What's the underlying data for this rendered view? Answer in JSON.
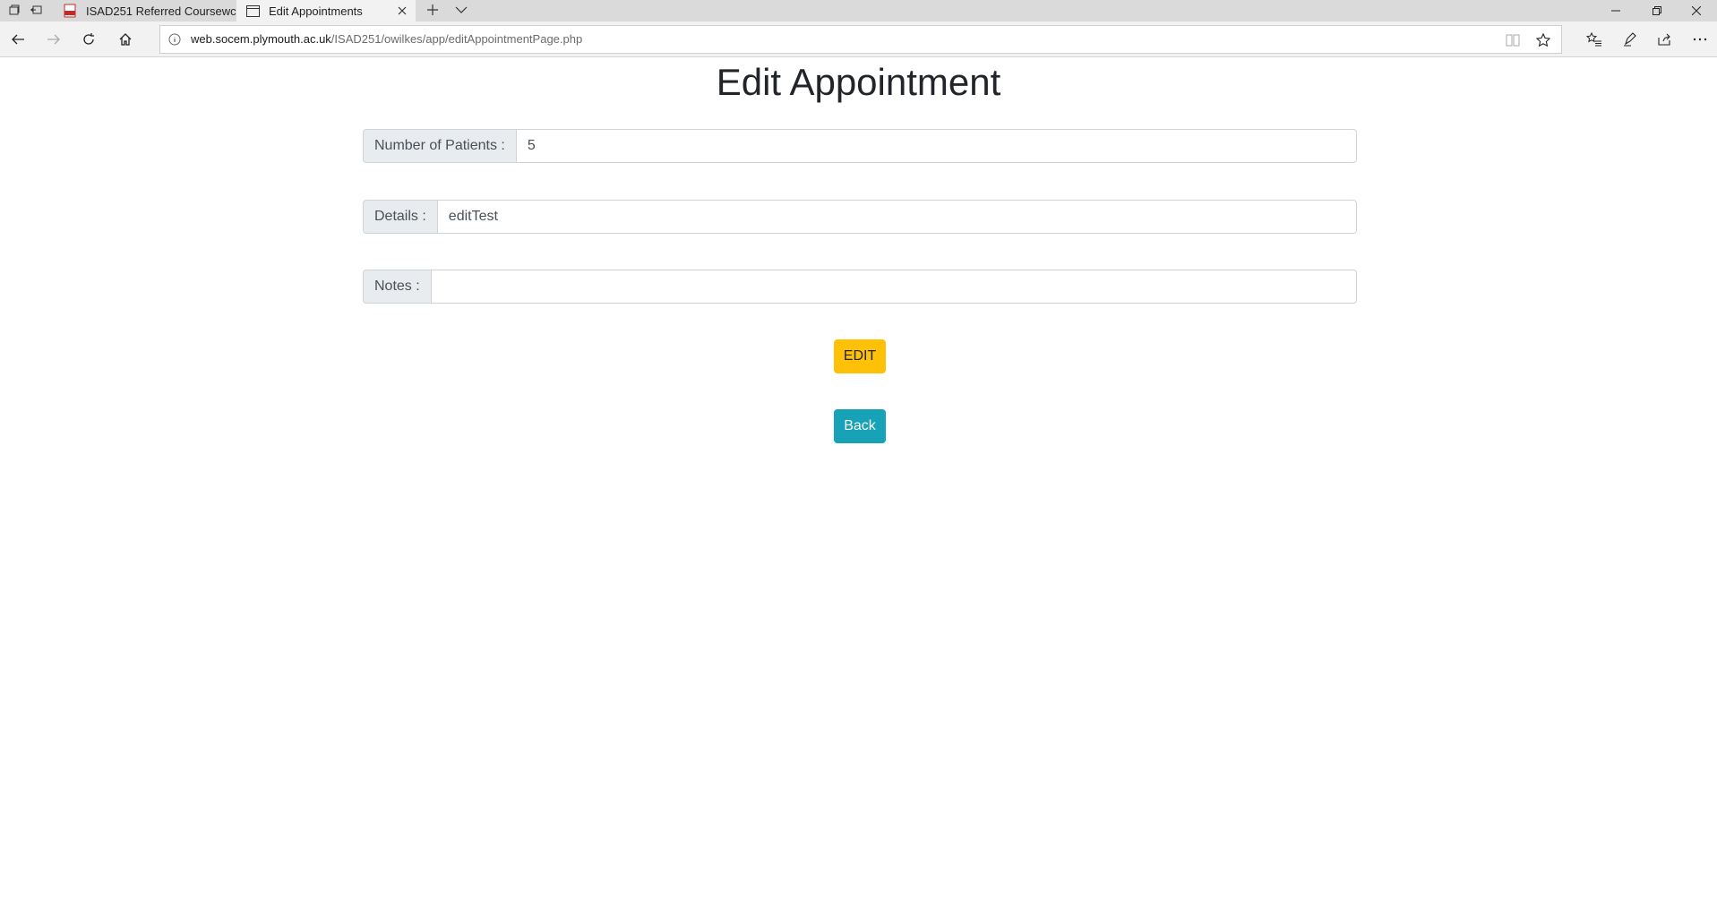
{
  "browser": {
    "tabs": [
      {
        "title": "ISAD251 Referred Coursewc",
        "active": false,
        "icon": "pdf-icon"
      },
      {
        "title": "Edit Appointments",
        "active": true,
        "icon": "page-icon"
      }
    ],
    "url_host": "web.socem.plymouth.ac.uk",
    "url_path": "/ISAD251/owilkes/app/editAppointmentPage.php"
  },
  "page": {
    "title": "Edit Appointment",
    "fields": [
      {
        "label": "Number of Patients :",
        "value": "5"
      },
      {
        "label": "Details :",
        "value": "editTest"
      },
      {
        "label": "Notes :",
        "value": ""
      }
    ],
    "edit_button": "EDIT",
    "back_button": "Back"
  },
  "colors": {
    "edit_button": "#ffc107",
    "back_button": "#17a2b8"
  }
}
